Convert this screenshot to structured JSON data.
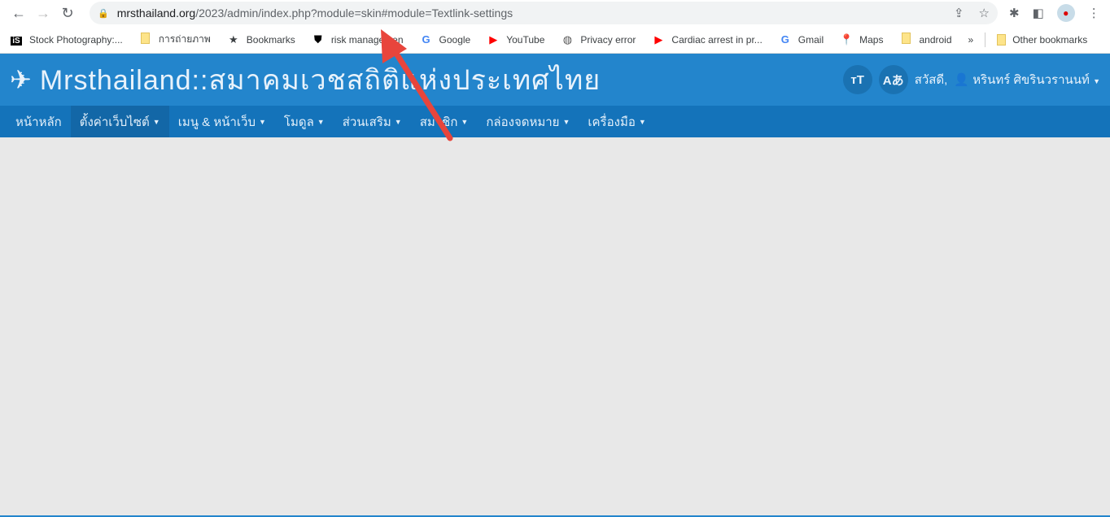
{
  "browser": {
    "url_host": "mrsthailand.org",
    "url_path": "/2023/admin/index.php?module=skin#module=Textlink-settings",
    "bookmarks": [
      {
        "label": "Stock Photography:...",
        "icon": "istock-icon"
      },
      {
        "label": "การถ่ายภาพ",
        "icon": "folder-icon"
      },
      {
        "label": "Bookmarks",
        "icon": "star-icon"
      },
      {
        "label": "risk managemen",
        "icon": "shield-icon"
      },
      {
        "label": "Google",
        "icon": "google-icon"
      },
      {
        "label": "YouTube",
        "icon": "youtube-icon"
      },
      {
        "label": "Privacy error",
        "icon": "globe-icon"
      },
      {
        "label": "Cardiac arrest in pr...",
        "icon": "youtube-icon"
      },
      {
        "label": "Gmail",
        "icon": "google-icon"
      },
      {
        "label": "Maps",
        "icon": "maps-icon"
      },
      {
        "label": "android",
        "icon": "folder-icon"
      }
    ],
    "more": "»",
    "other_bookmarks": "Other bookmarks"
  },
  "header": {
    "title": "Mrsthailand::สมาคมเวชสถิติแห่งประเทศไทย",
    "font_btn": "тT",
    "lang_btn": "Aあ",
    "greeting": "สวัสดี,",
    "user": "หรินทร์ ศิขรินวรานนท์"
  },
  "menu": [
    {
      "label": "หน้าหลัก",
      "dropdown": false
    },
    {
      "label": "ตั้งค่าเว็บไซต์",
      "dropdown": true,
      "active": true
    },
    {
      "label": "เมนู & หน้าเว็บ",
      "dropdown": true
    },
    {
      "label": "โมดูล",
      "dropdown": true
    },
    {
      "label": "ส่วนเสริม",
      "dropdown": true
    },
    {
      "label": "สมาชิก",
      "dropdown": true
    },
    {
      "label": "กล่องจดหมาย",
      "dropdown": true
    },
    {
      "label": "เครื่องมือ",
      "dropdown": true
    }
  ],
  "colors": {
    "header": "#2385cc",
    "menu": "#1473ba",
    "annotation_arrow": "#e8453c",
    "background": "#e8e8e8"
  }
}
